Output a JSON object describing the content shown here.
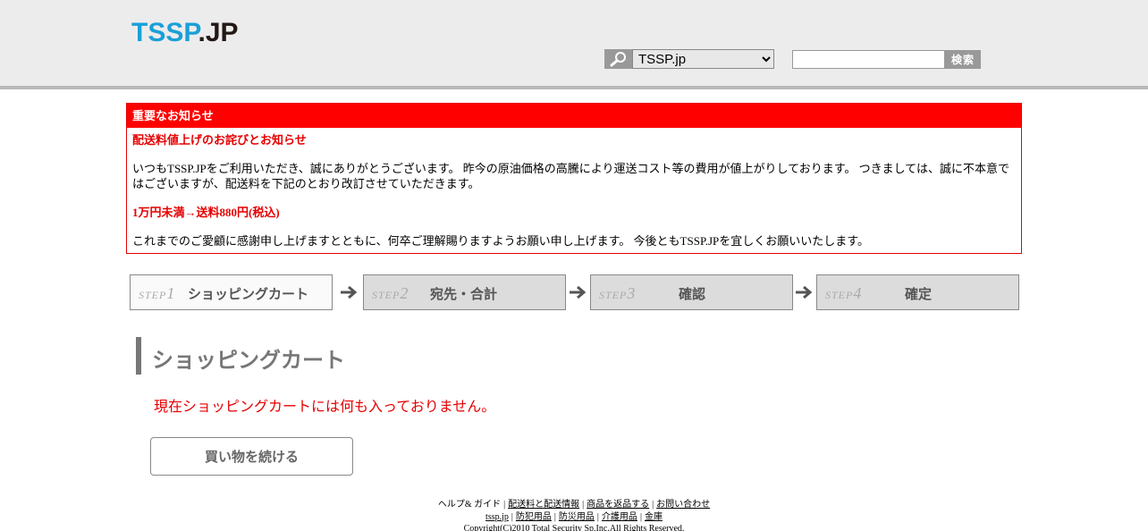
{
  "header": {
    "logo_part1": "TSSP",
    "logo_part2": ".JP",
    "site_select": {
      "selected": "TSSP.jp",
      "options": [
        "TSSP.jp"
      ]
    },
    "search": {
      "value": "",
      "button_label": "検索"
    }
  },
  "notice": {
    "title": "重要なお知らせ",
    "headline": "配送料値上げのお詫びとお知らせ",
    "body1": "いつもTSSP.JPをご利用いただき、誠にありがとうございます。 昨今の原油価格の高騰により運送コスト等の費用が値上がりしております。 つきましては、誠に不本意ではございますが、配送料を下記のとおり改訂させていただきます。",
    "price_line": "1万円未満→送料880円(税込)",
    "body2": "これまでのご愛顧に感謝申し上げますとともに、何卒ご理解賜りますようお願い申し上げます。 今後ともTSSP.JPを宜しくお願いいたします。"
  },
  "steps": [
    {
      "prefix": "STEP",
      "num": "1",
      "label": "ショッピングカート",
      "state": "active"
    },
    {
      "prefix": "STEP",
      "num": "2",
      "label": "宛先・合計",
      "state": "inactive"
    },
    {
      "prefix": "STEP",
      "num": "3",
      "label": "確認",
      "state": "inactive"
    },
    {
      "prefix": "STEP",
      "num": "4",
      "label": "確定",
      "state": "inactive"
    }
  ],
  "cart": {
    "title": "ショッピングカート",
    "empty_message": "現在ショッピングカートには何も入っておりません。",
    "continue_label": "買い物を続ける"
  },
  "footer": {
    "row1": {
      "help": "ヘルプ& ガイド",
      "links": [
        "配送料と配送情報",
        "商品を返品する",
        "お問い合わせ"
      ]
    },
    "row2": {
      "links": [
        "tssp.jp",
        "防犯用品",
        "防災用品",
        "介護用品",
        "金庫"
      ]
    },
    "copyright": "Copyright(C)2010 Total Security Sp.Inc.All Rights Reserved."
  },
  "colors": {
    "accent_red": "#ff0000",
    "logo_blue": "#1aa0d8",
    "header_bg": "#edeced"
  }
}
